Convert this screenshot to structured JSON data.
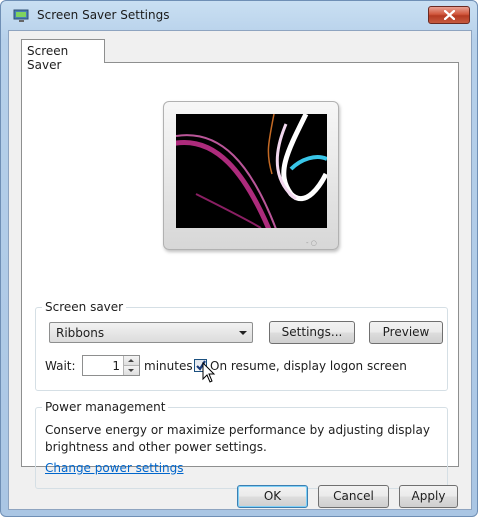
{
  "window": {
    "title": "Screen Saver Settings",
    "icon": "monitor-app-icon",
    "close_icon": "close-icon"
  },
  "tabs": [
    {
      "label": "Screen Saver",
      "selected": true
    }
  ],
  "preview": {
    "monitor_icon": "monitor-preview",
    "led_text": "- ○"
  },
  "screen_saver": {
    "group_label": "Screen saver",
    "selected": "Ribbons",
    "settings_label": "Settings...",
    "preview_label": "Preview",
    "wait_label": "Wait:",
    "wait_value": "1",
    "minutes_label": "minutes",
    "resume_checked": true,
    "resume_label": "On resume, display logon screen"
  },
  "power": {
    "group_label": "Power management",
    "description_line1": "Conserve energy or maximize performance by adjusting display",
    "description_line2": "brightness and other power settings.",
    "link_label": "Change power settings"
  },
  "footer": {
    "ok_label": "OK",
    "cancel_label": "Cancel",
    "apply_label": "Apply"
  },
  "colors": {
    "title_bar": "#b6d0ea",
    "close_button": "#d2583e",
    "link": "#0066cc"
  }
}
